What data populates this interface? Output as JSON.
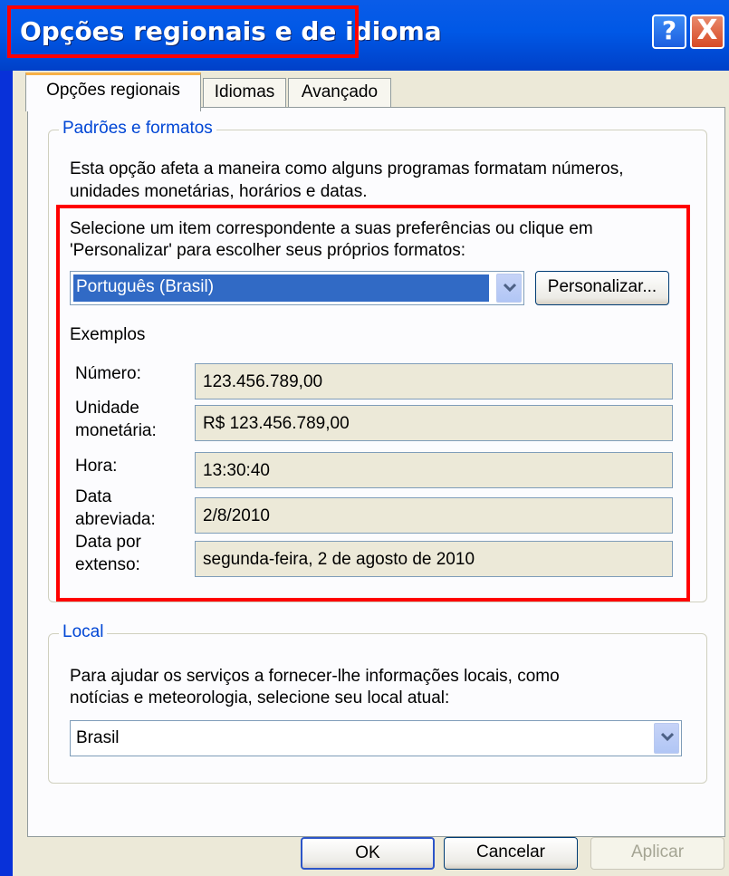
{
  "window": {
    "title": "Opções regionais e de idioma",
    "help_glyph": "?",
    "close_glyph": "X"
  },
  "tabs": [
    {
      "label": "Opções regionais",
      "active": true
    },
    {
      "label": "Idiomas",
      "active": false
    },
    {
      "label": "Avançado",
      "active": false
    }
  ],
  "standards": {
    "legend": "Padrões e formatos",
    "description_line1": "Esta opção afeta a maneira como alguns programas formatam números,",
    "description_line2": "unidades monetárias, horários e datas.",
    "prompt_line1": "Selecione um item correspondente a suas preferências ou clique em",
    "prompt_line2": "'Personalizar' para escolher seus próprios formatos:",
    "selected_locale": "Português (Brasil)",
    "customize_label": "Personalizar...",
    "examples_heading": "Exemplos",
    "examples": [
      {
        "label_line1": "Número:",
        "label_line2": "",
        "value": "123.456.789,00"
      },
      {
        "label_line1": "Unidade",
        "label_line2": "monetária:",
        "value": "R$ 123.456.789,00"
      },
      {
        "label_line1": "Hora:",
        "label_line2": "",
        "value": "13:30:40"
      },
      {
        "label_line1": "Data",
        "label_line2": "abreviada:",
        "value": "2/8/2010"
      },
      {
        "label_line1": "Data por",
        "label_line2": "extenso:",
        "value": "segunda-feira, 2 de agosto de 2010"
      }
    ]
  },
  "location": {
    "legend": "Local",
    "description_line1": "Para ajudar os serviços a fornecer-lhe informações locais, como",
    "description_line2": "notícias e meteorologia, selecione seu local atual:",
    "selected": "Brasil"
  },
  "footer": {
    "ok_label": "OK",
    "cancel_label": "Cancelar",
    "apply_label": "Aplicar"
  },
  "colors": {
    "title_bar": "#0058e6",
    "highlight_box": "#ff0000",
    "legend_text": "#0046d5",
    "selection": "#316ac5"
  }
}
